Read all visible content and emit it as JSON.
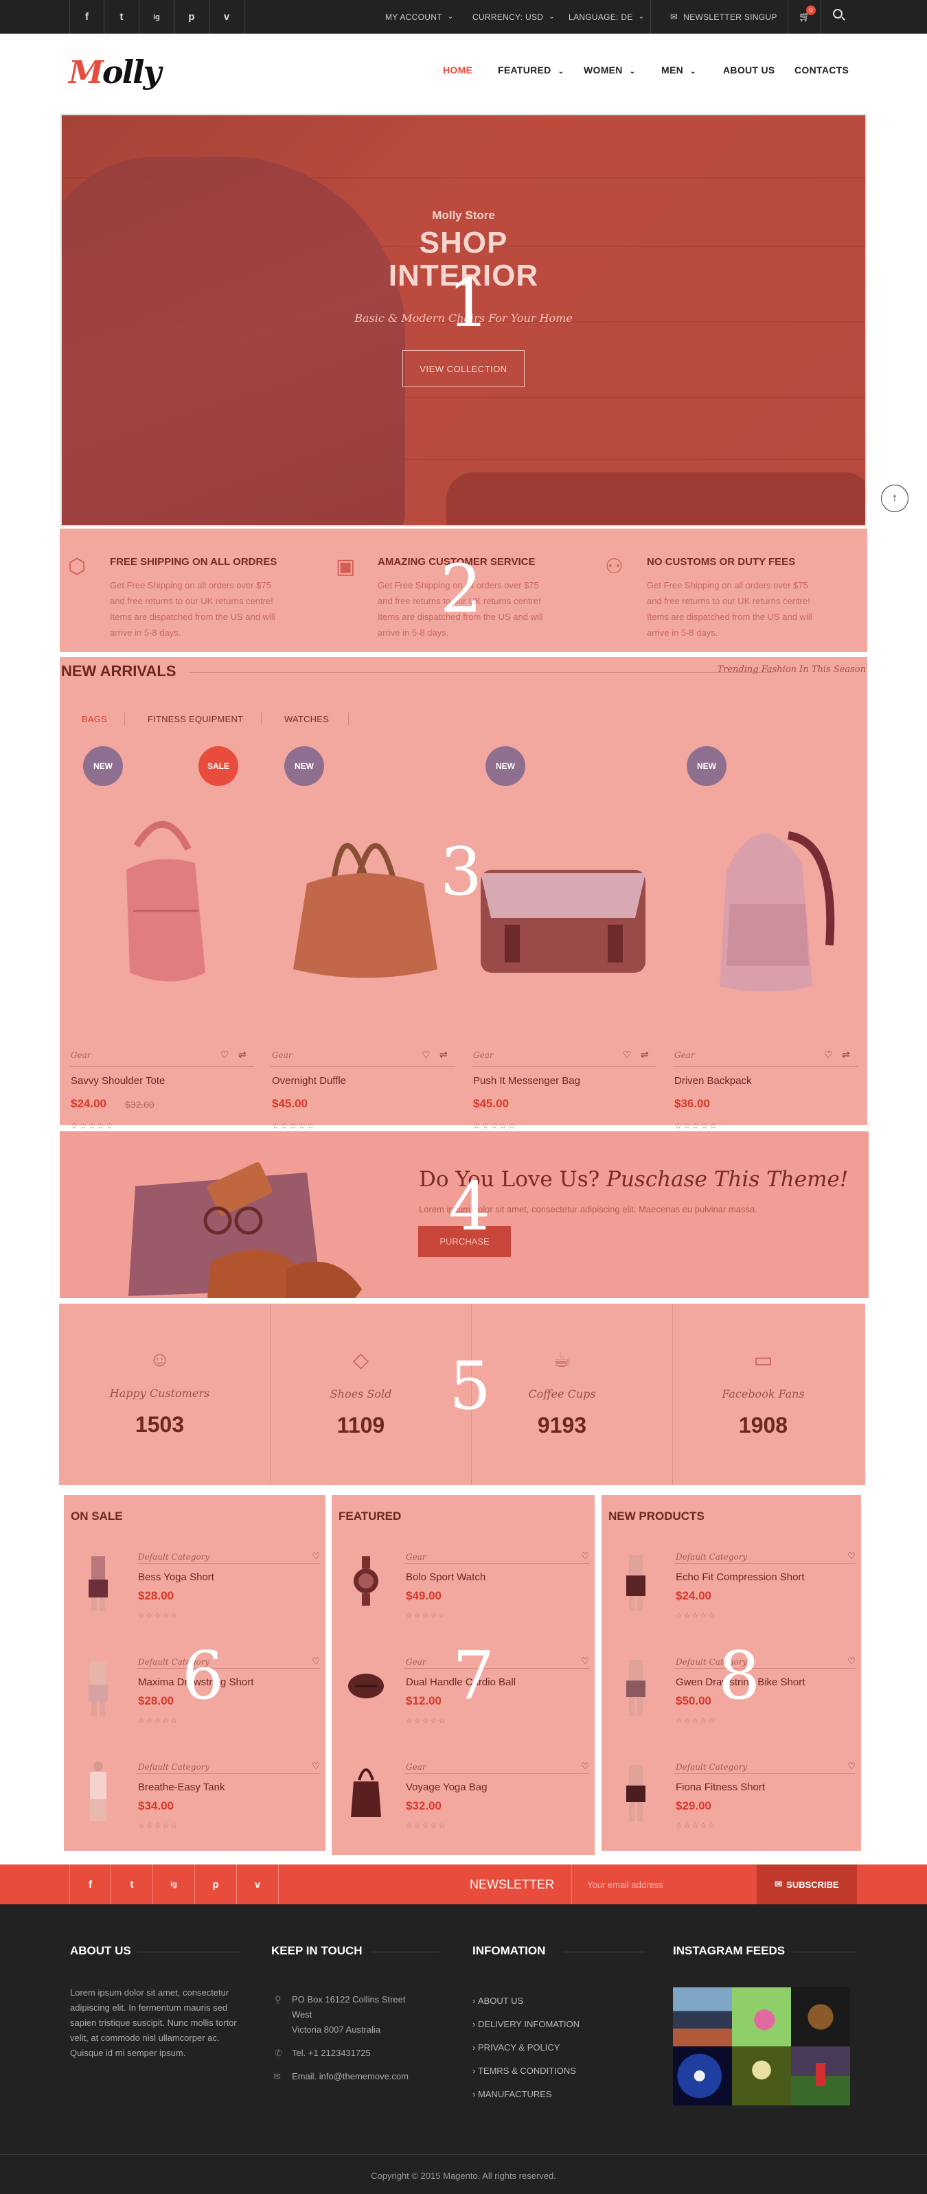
{
  "topbar": {
    "social": [
      "f",
      "t",
      "ig",
      "p",
      "v"
    ],
    "my_account": "MY ACCOUNT",
    "currency": "CURRENCY: USD",
    "language": "LANGUAGE: DE",
    "newsletter": "NEWSLETTER SINGUP",
    "cart_count": "0"
  },
  "header": {
    "logo": "Molly",
    "nav": [
      "HOME",
      "FEATURED",
      "WOMEN",
      "MEN",
      "ABOUT US",
      "CONTACTS"
    ]
  },
  "hero": {
    "store": "Molly Store",
    "title_line1": "SHOP",
    "title_line2": "INTERIOR",
    "subtitle": "Basic & Modern Chairs For Your Home",
    "button": "VIEW COLLECTION",
    "overlay_number": "1"
  },
  "features": {
    "overlay_number": "2",
    "items": [
      {
        "icon": "box-icon",
        "title": "FREE SHIPPING ON ALL ORDRES",
        "text": "Get Free Shipping on all orders over $75 and free returns to our UK returns centre! Items are dispatched from the US and will arrive in 5-8 days."
      },
      {
        "icon": "wallet-icon",
        "title": "AMAZING CUSTOMER SERVICE",
        "text": "Get Free Shipping on all orders over $75 and free returns to our UK returns centre! Items are dispatched from the US and will arrive in 5-8 days."
      },
      {
        "icon": "user-add-icon",
        "title": "NO CUSTOMS OR DUTY FEES",
        "text": "Get Free Shipping on all orders over $75 and free returns to our UK returns centre! Items are dispatched from the US and will arrive in 5-8 days."
      }
    ]
  },
  "arrivals": {
    "title": "NEW ARRIVALS",
    "tagline": "Trending Fashion In This Season",
    "overlay_number": "3",
    "tabs": [
      "BAGS",
      "FITNESS EQUIPMENT",
      "WATCHES"
    ],
    "products": [
      {
        "badge": "NEW",
        "badge2": "SALE",
        "category": "Gear",
        "name": "Savvy Shoulder Tote",
        "price": "$24.00",
        "old_price": "$32.00",
        "stars": "☆☆☆☆☆"
      },
      {
        "badge": "NEW",
        "category": "Gear",
        "name": "Overnight Duffle",
        "price": "$45.00",
        "stars": "☆☆☆☆☆"
      },
      {
        "badge": "NEW",
        "category": "Gear",
        "name": "Push It Messenger Bag",
        "price": "$45.00",
        "stars": "☆☆☆☆☆"
      },
      {
        "badge": "NEW",
        "category": "Gear",
        "name": "Driven Backpack",
        "price": "$36.00",
        "stars": "☆☆☆☆☆"
      }
    ]
  },
  "promo": {
    "title_plain": "Do You Love Us?",
    "title_italic": "Puschase This Theme!",
    "text": "Lorem ipsum dolor sit amet, consectetur adipiscing elit. Maecenas eu pulvinar massa.",
    "button": "PURCHASE",
    "overlay_number": "4"
  },
  "counters": {
    "overlay_number": "5",
    "items": [
      {
        "icon": "smile-icon",
        "label": "Happy Customers",
        "value": "1503"
      },
      {
        "icon": "diamond-icon",
        "label": "Shoes Sold",
        "value": "1109"
      },
      {
        "icon": "coffee-icon",
        "label": "Coffee Cups",
        "value": "9193"
      },
      {
        "icon": "chat-icon",
        "label": "Facebook Fans",
        "value": "1908"
      }
    ]
  },
  "lists": [
    {
      "title": "ON SALE",
      "overlay_number": "6",
      "items": [
        {
          "category": "Default Category",
          "name": "Bess Yoga Short",
          "price": "$28.00",
          "stars": "☆☆☆☆☆"
        },
        {
          "category": "Default Category",
          "name": "Maxima Drawstring Short",
          "price": "$28.00",
          "stars": "☆☆☆☆☆"
        },
        {
          "category": "Default Category",
          "name": "Breathe-Easy Tank",
          "price": "$34.00",
          "stars": "☆☆☆☆☆"
        }
      ]
    },
    {
      "title": "FEATURED",
      "overlay_number": "7",
      "items": [
        {
          "category": "Gear",
          "name": "Bolo Sport Watch",
          "price": "$49.00",
          "stars": "☆☆☆☆☆"
        },
        {
          "category": "Gear",
          "name": "Dual Handle Cardio Ball",
          "price": "$12.00",
          "stars": "☆☆☆☆☆"
        },
        {
          "category": "Gear",
          "name": "Voyage Yoga Bag",
          "price": "$32.00",
          "stars": "☆☆☆☆☆"
        }
      ]
    },
    {
      "title": "NEW PRODUCTS",
      "overlay_number": "8",
      "items": [
        {
          "category": "Default Category",
          "name": "Echo Fit Compression Short",
          "price": "$24.00",
          "stars": "☆☆☆☆☆"
        },
        {
          "category": "Default Category",
          "name": "Gwen Drawstring Bike Short",
          "price": "$50.00",
          "stars": "☆☆☆☆☆"
        },
        {
          "category": "Default Category",
          "name": "Fiona Fitness Short",
          "price": "$29.00",
          "stars": "☆☆☆☆☆"
        }
      ]
    }
  ],
  "newsletter": {
    "title": "NEWSLETTER",
    "placeholder": "Your email address",
    "button": "SUBSCRIBE"
  },
  "footer": {
    "about_title": "ABOUT US",
    "about_text": "Lorem ipsum dolor sit amet, consectetur adipiscing elit. In fermentum mauris sed sapien tristique suscipit. Nunc mollis tortor velit, at commodo nisl ullamcorper ac. Quisque id mi semper ipsum.",
    "touch_title": "KEEP IN TOUCH",
    "address_line1": "PO Box 16122 Collins Street",
    "address_line2": "West",
    "address_line3": "Victoria 8007 Australia",
    "phone": "Tel. +1 2123431725",
    "email": "Email. info@thememove.com",
    "info_title": "INFOMATION",
    "info_links": [
      "ABOUT US",
      "DELIVERY INFOMATION",
      "PRIVACY & POLICY",
      "TEMRS & CONDITIONS",
      "MANUFACTURES"
    ],
    "insta_title": "INSTAGRAM FEEDS",
    "copyright": "Copyright © 2015 Magento. All rights reserved."
  },
  "colors": {
    "accent": "#e74c3c",
    "dark": "#222222",
    "overlay": "#f0a097"
  }
}
